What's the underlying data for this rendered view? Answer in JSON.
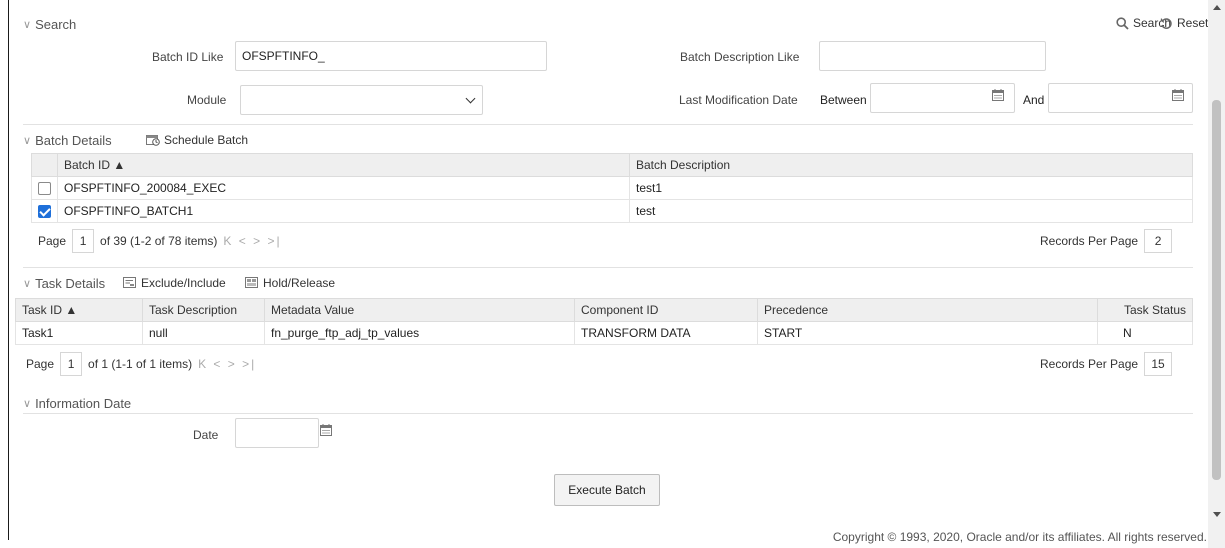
{
  "search": {
    "title": "Search",
    "search_label": "Search",
    "reset_label": "Reset",
    "batch_id_label": "Batch ID Like",
    "batch_id_value": "OFSPFTINFO_",
    "batch_desc_label": "Batch Description Like",
    "batch_desc_value": "",
    "module_label": "Module",
    "module_value": "",
    "last_mod_label": "Last Modification Date",
    "between_label": "Between",
    "and_label": "And",
    "between_value": "",
    "and_value": ""
  },
  "batch_details": {
    "title": "Batch Details",
    "schedule_label": "Schedule Batch",
    "columns": [
      "Batch ID ▲",
      "Batch Description"
    ],
    "rows": [
      {
        "id": "OFSPFTINFO_200084_EXEC",
        "desc": "test1",
        "checked": false
      },
      {
        "id": "OFSPFTINFO_BATCH1",
        "desc": "test",
        "checked": true
      }
    ],
    "pager": {
      "page_label": "Page",
      "page": "1",
      "info": "of 39 (1-2 of 78 items)",
      "nav": "K < > >|",
      "rpp_label": "Records Per Page",
      "rpp": "2"
    }
  },
  "task_details": {
    "title": "Task Details",
    "exclude_label": "Exclude/Include",
    "hold_label": "Hold/Release",
    "columns": [
      "Task ID ▲",
      "Task Description",
      "Metadata Value",
      "Component ID",
      "Precedence",
      "Task Status"
    ],
    "rows": [
      {
        "task_id": "Task1",
        "desc": "null",
        "metadata": "fn_purge_ftp_adj_tp_values",
        "component": "TRANSFORM DATA",
        "precedence": "START",
        "status": "N"
      }
    ],
    "pager": {
      "page_label": "Page",
      "page": "1",
      "info": "of 1 (1-1 of 1 items)",
      "nav": "K < > >|",
      "rpp_label": "Records Per Page",
      "rpp": "15"
    }
  },
  "info_date": {
    "title": "Information Date",
    "date_label": "Date",
    "date_value": ""
  },
  "execute_label": "Execute Batch",
  "footer": "Copyright © 1993, 2020, Oracle and/or its affiliates. All rights reserved.",
  "colors": {
    "accent": "#1e6fd9",
    "header_bg": "#efefef",
    "border": "#dcdcdc"
  }
}
